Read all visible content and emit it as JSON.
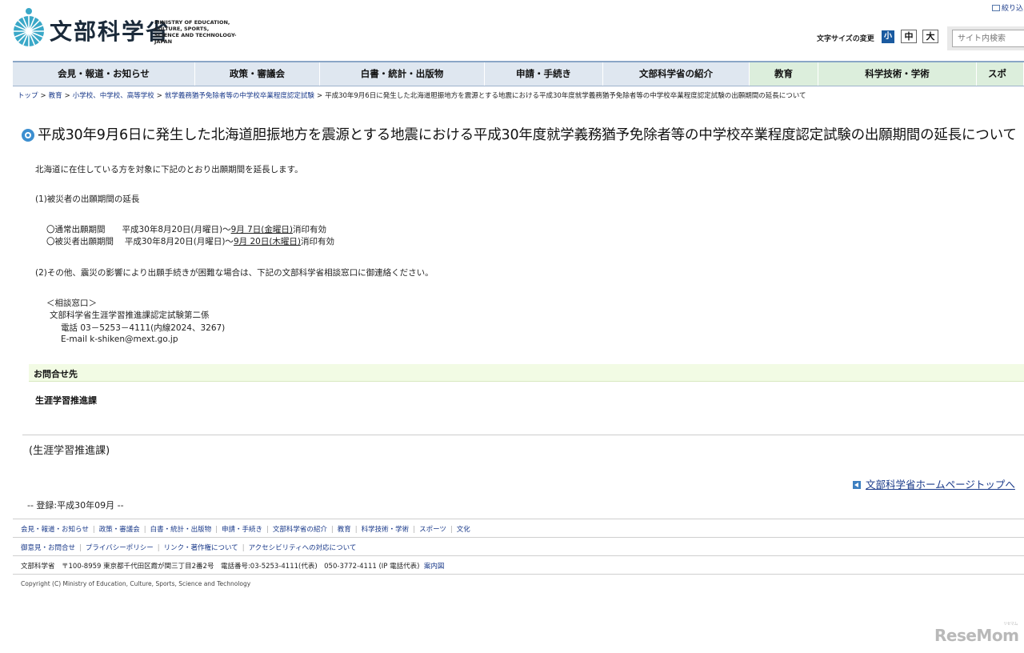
{
  "header": {
    "logo_text": "文部科学省",
    "logo_en_lines": [
      "MINISTRY OF EDUCATION,",
      "CULTURE, SPORTS,",
      "SCIENCE AND TECHNOLOGY-JAPAN"
    ],
    "top_link": "絞り込",
    "fontsize_label": "文字サイズの変更",
    "fontsize_small": "小",
    "fontsize_medium": "中",
    "fontsize_large": "大",
    "search_placeholder": "サイト内検索"
  },
  "nav": {
    "items": [
      {
        "label": "会見・報道・お知らせ",
        "green": false
      },
      {
        "label": "政策・審議会",
        "green": false
      },
      {
        "label": "白書・統計・出版物",
        "green": false
      },
      {
        "label": "申請・手続き",
        "green": false
      },
      {
        "label": "文部科学省の紹介",
        "green": false
      },
      {
        "label": "教育",
        "green": true
      },
      {
        "label": "科学技術・学術",
        "green": true
      },
      {
        "label": "スポ",
        "green": true
      }
    ]
  },
  "breadcrumb": {
    "items": [
      "トップ",
      "教育",
      "小学校、中学校、高等学校",
      "就学義務猶予免除者等の中学校卒業程度認定試験"
    ],
    "current": "平成30年9月6日に発生した北海道胆振地方を震源とする地震における平成30年度就学義務猶予免除者等の中学校卒業程度認定試験の出願期間の延長について"
  },
  "main": {
    "title": "平成30年9月6日に発生した北海道胆振地方を震源とする地震における平成30年度就学義務猶予免除者等の中学校卒業程度認定試験の出願期間の延長について",
    "intro": "北海道に在住している方を対象に下記のとおり出願期間を延長します。",
    "section1_heading": "(1)被災者の出願期間の延長",
    "normal_prefix": "〇通常出願期間　　平成30年8月20日(月曜日)～",
    "normal_date": "9月 7日(金曜日)",
    "normal_suffix": "消印有効",
    "disaster_prefix": "〇被災者出願期間　 平成30年8月20日(月曜日)～",
    "disaster_date": "9月 20日(木曜日)",
    "disaster_suffix": "消印有効",
    "section2": "(2)その他、震災の影響により出願手続きが困難な場合は、下記の文部科学省相談窓口に御連絡ください。",
    "consult_heading": "＜相談窓口＞",
    "consult_office": "文部科学省生涯学習推進課認定試験第二係",
    "consult_phone": "電話  03－5253－4111(内線2024、3267)",
    "consult_email": "E-mail  k-shiken@mext.go.jp",
    "contact_heading": "お問合せ先",
    "contact_dept": "生涯学習推進課",
    "dept_paren": "(生涯学習推進課)",
    "home_link": "文部科学省ホームページトップへ",
    "registered": "-- 登録:平成30年09月 --"
  },
  "footer": {
    "links1": [
      "会見・報道・お知らせ",
      "政策・審議会",
      "白書・統計・出版物",
      "申請・手続き",
      "文部科学省の紹介",
      "教育",
      "科学技術・学術",
      "スポーツ",
      "文化"
    ],
    "links2": [
      "御意見・お問合せ",
      "プライバシーポリシー",
      "リンク・著作権について",
      "アクセシビリティへの対応について"
    ],
    "address": "文部科学省　〒100-8959 東京都千代田区霞が関三丁目2番2号　電話番号:03-5253-4111(代表)　050-3772-4111 (IP 電話代表)",
    "address_link": "案内図",
    "copyright": "Copyright (C) Ministry of Education, Culture, Sports, Science and Technology"
  },
  "watermark": {
    "text": "ReseMom",
    "small": "リセマム"
  }
}
